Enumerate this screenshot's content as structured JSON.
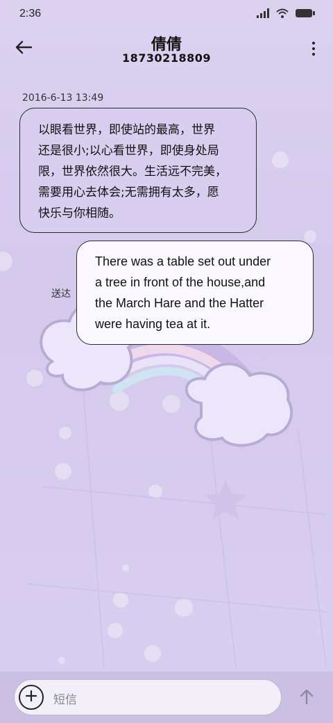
{
  "status_bar": {
    "time": "2:36"
  },
  "header": {
    "contact_name": "倩倩",
    "phone_number": "18730218809"
  },
  "messages": {
    "timestamp": "2016-6-13 13:49",
    "incoming": {
      "lines": [
        "以眼看世界，即使站的最高，世界",
        "还是很小;以心看世界，即使身处局",
        "限，世界依然很大。生活远不完美，",
        "需要用心去体会;无需拥有太多，愿",
        "快乐与你相随。"
      ]
    },
    "outgoing": {
      "lines": [
        "There was a table set out under",
        "a tree in front of the house,and",
        "the March Hare and the Hatter",
        "were having tea at it."
      ],
      "status": "送达"
    }
  },
  "composer": {
    "placeholder": "短信"
  },
  "colors": {
    "background": "#d8cdee",
    "incoming_bubble": "#d9cdf0",
    "outgoing_bubble": "#fbf9ff",
    "input_bar": "#cbc0e3"
  },
  "icons": {
    "back": "arrow-left-icon",
    "more": "more-vertical-icon",
    "add": "plus-circle-icon",
    "send": "arrow-up-icon",
    "signal": "signal-icon",
    "wifi": "wifi-icon",
    "battery": "battery-icon"
  }
}
